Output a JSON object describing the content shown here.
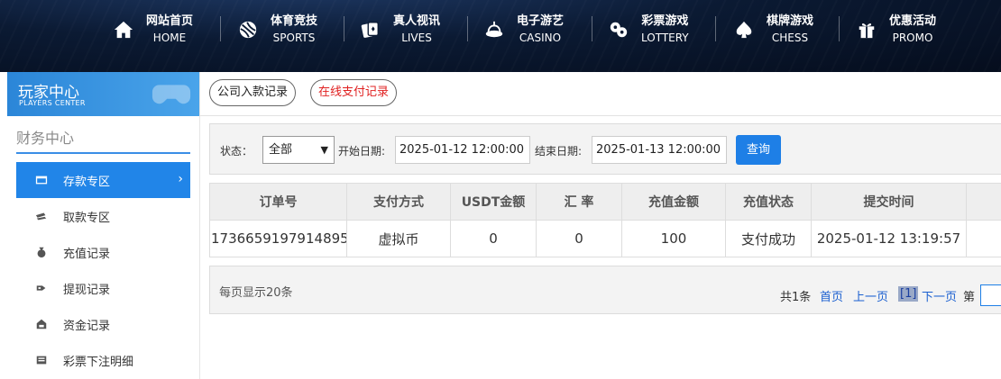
{
  "nav": [
    {
      "cn": "网站首页",
      "en": "HOME",
      "icon": "home-icon"
    },
    {
      "cn": "体育竞技",
      "en": "SPORTS",
      "icon": "ball-icon"
    },
    {
      "cn": "真人视讯",
      "en": "LIVES",
      "icon": "cards-icon"
    },
    {
      "cn": "电子游艺",
      "en": "CASINO",
      "icon": "slot-icon"
    },
    {
      "cn": "彩票游戏",
      "en": "LOTTERY",
      "icon": "lottery-balls-icon"
    },
    {
      "cn": "棋牌游戏",
      "en": "CHESS",
      "icon": "spade-icon"
    },
    {
      "cn": "优惠活动",
      "en": "PROMO",
      "icon": "gift-icon"
    }
  ],
  "sidebar": {
    "header_title": "玩家中心",
    "header_sub": "PLAYERS CENTER",
    "section_title": "财务中心",
    "items": [
      {
        "label": "存款专区",
        "icon": "wallet-icon",
        "active": true
      },
      {
        "label": "取款专区",
        "icon": "cash-icon"
      },
      {
        "label": "充值记录",
        "icon": "money-bag-icon"
      },
      {
        "label": "提现记录",
        "icon": "withdraw-icon"
      },
      {
        "label": "资金记录",
        "icon": "fund-icon"
      },
      {
        "label": "彩票下注明细",
        "icon": "list-icon"
      }
    ]
  },
  "tabs": {
    "company": "公司入款记录",
    "online": "在线支付记录"
  },
  "filter": {
    "status_label": "状态：",
    "status_value": "全部",
    "start_label": "开始日期:",
    "start_value": "2025-01-12 12:00:00",
    "end_label": "结束日期:",
    "end_value": "2025-01-13 12:00:00",
    "query_button": "查询"
  },
  "table": {
    "headers": [
      "订单号",
      "支付方式",
      "USDT金额",
      "汇 率",
      "充值金额",
      "充值状态",
      "提交时间"
    ],
    "rows": [
      [
        "1736659197914895",
        "虚拟币",
        "0",
        "0",
        "100",
        "支付成功",
        "2025-01-12 13:19:57"
      ]
    ]
  },
  "pager": {
    "per_page": "每页显示20条",
    "total": "共1条",
    "first": "首页",
    "prev": "上一页",
    "current": "[1]",
    "next": "下一页",
    "page_label": "第"
  },
  "colors": {
    "accent": "#2185e8",
    "tab_red": "#e02020",
    "link": "#1a5fd0"
  }
}
